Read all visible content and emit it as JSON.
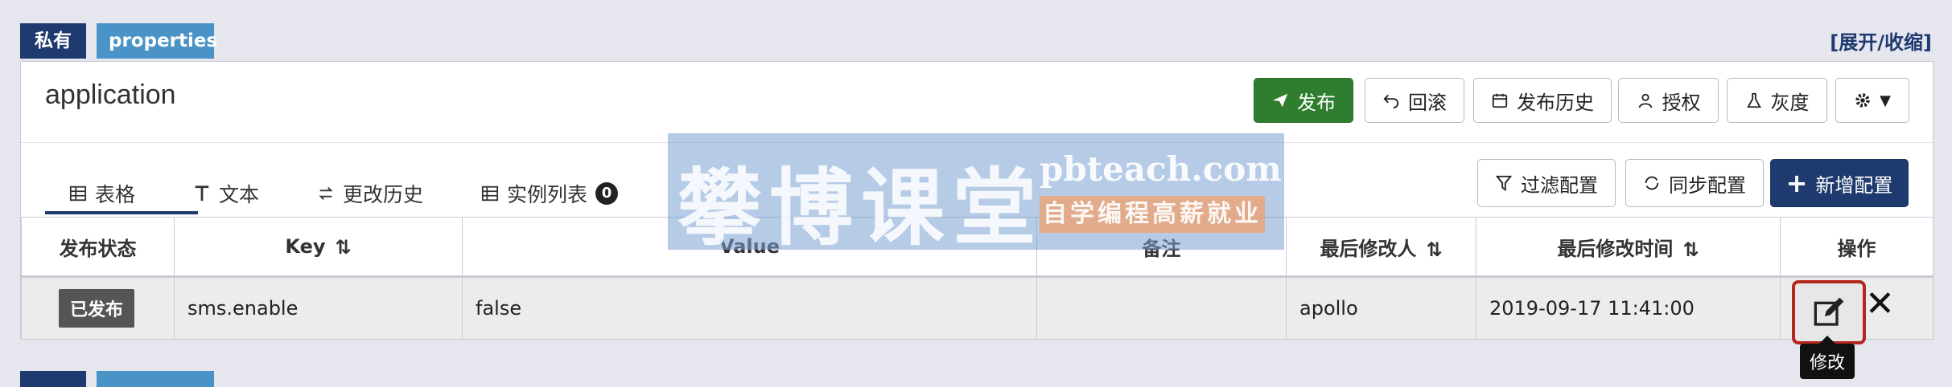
{
  "namespace": {
    "private_tag": "私有",
    "name_tag": "properties",
    "toggle_link": "[展开/收缩]",
    "app_name": "application"
  },
  "toolbar": {
    "publish": "发布",
    "rollback": "回滚",
    "publish_history": "发布历史",
    "authorize": "授权",
    "gray": "灰度"
  },
  "tabs": [
    {
      "label": "表格",
      "icon": "table-icon"
    },
    {
      "label": "文本",
      "icon": "text-icon"
    },
    {
      "label": "更改历史",
      "icon": "history-icon"
    },
    {
      "label": "实例列表",
      "icon": "instance-list-icon",
      "badge": "0"
    }
  ],
  "actions": {
    "filter": "过滤配置",
    "sync": "同步配置",
    "add": "新增配置"
  },
  "table": {
    "headers": [
      "发布状态",
      "Key",
      "Value",
      "备注",
      "最后修改人",
      "最后修改时间",
      "操作"
    ],
    "rows": [
      {
        "status": "已发布",
        "key": "sms.enable",
        "value": "false",
        "comment": "",
        "modifier": "apollo",
        "modified_time": "2019-09-17 11:41:00"
      }
    ]
  },
  "tooltip": "修改",
  "watermark": {
    "cn": "攀博课堂",
    "domain": "pbteach.com",
    "slogan": "自学编程高薪就业"
  },
  "colors": {
    "navy": "#1e3a6e",
    "blue_tag": "#4a93c7",
    "green": "#2f7d2f",
    "highlight": "#b3271e"
  }
}
